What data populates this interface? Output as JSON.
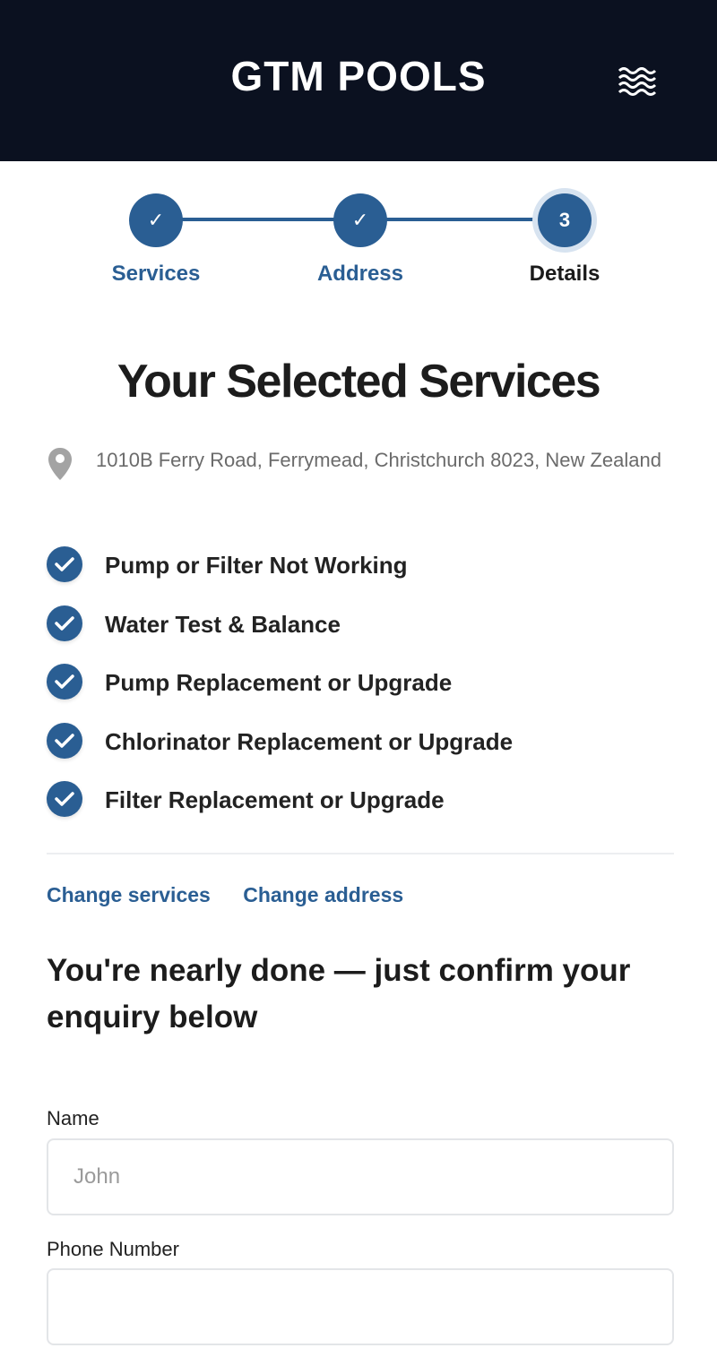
{
  "header": {
    "brand": "GTM POOLS",
    "menu_icon": "waves-menu-icon"
  },
  "stepper": {
    "steps": [
      {
        "label": "Services",
        "marker": "✓",
        "state": "complete"
      },
      {
        "label": "Address",
        "marker": "✓",
        "state": "complete"
      },
      {
        "label": "Details",
        "marker": "3",
        "state": "current"
      }
    ]
  },
  "summary": {
    "title": "Your Selected Services",
    "address": "1010B Ferry Road, Ferrymead, Christchurch 8023, New Zealand",
    "services": [
      "Pump or Filter Not Working",
      "Water Test & Balance",
      "Pump Replacement or Upgrade",
      "Chlorinator Replacement or Upgrade",
      "Filter Replacement or Upgrade"
    ],
    "change_services": "Change services",
    "change_address": "Change address"
  },
  "form": {
    "heading": "You're nearly done — just confirm your enquiry below",
    "name_label": "Name",
    "name_placeholder": "John",
    "name_value": "",
    "phone_label": "Phone Number",
    "phone_placeholder": "",
    "phone_value": ""
  },
  "colors": {
    "header_bg": "#0b1120",
    "accent": "#2a5e93"
  }
}
